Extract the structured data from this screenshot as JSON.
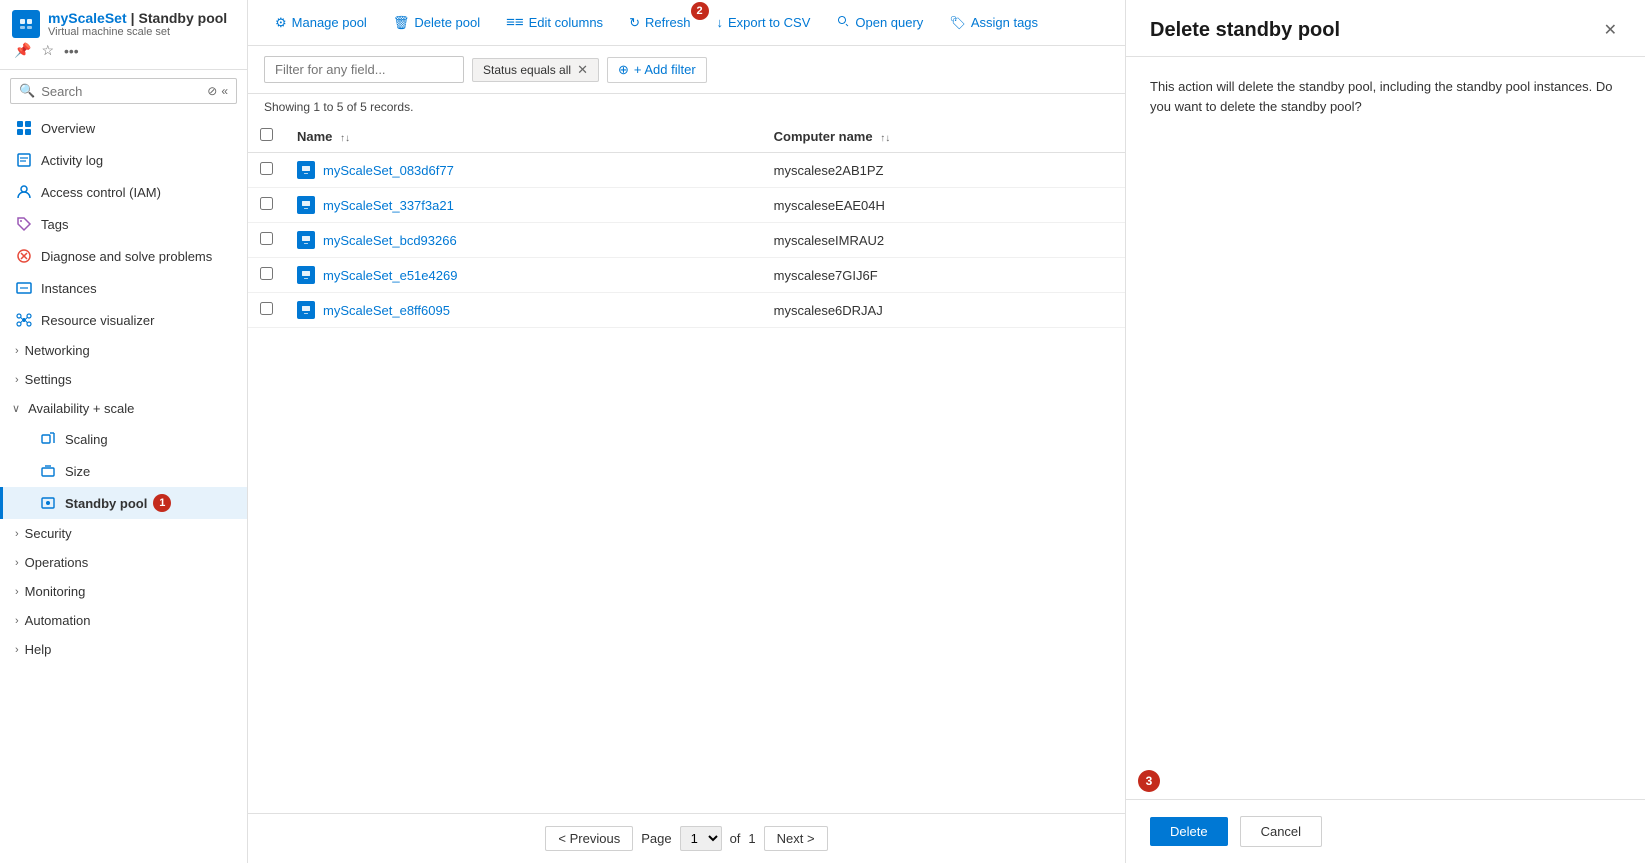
{
  "app": {
    "resource_icon": "⚙",
    "resource_name": "myScaleSet",
    "resource_separator": " | ",
    "resource_page": "Standby pool",
    "resource_subtitle": "Virtual machine scale set",
    "header_actions": [
      "📌",
      "☆",
      "…"
    ]
  },
  "sidebar": {
    "search_placeholder": "Search",
    "nav_items": [
      {
        "id": "overview",
        "label": "Overview",
        "icon": "overview",
        "level": 0
      },
      {
        "id": "activity-log",
        "label": "Activity log",
        "icon": "activity",
        "level": 0
      },
      {
        "id": "iam",
        "label": "Access control (IAM)",
        "icon": "iam",
        "level": 0
      },
      {
        "id": "tags",
        "label": "Tags",
        "icon": "tags",
        "level": 0
      },
      {
        "id": "diagnose",
        "label": "Diagnose and solve problems",
        "icon": "diagnose",
        "level": 0
      },
      {
        "id": "instances",
        "label": "Instances",
        "icon": "instances",
        "level": 0
      },
      {
        "id": "resource-viz",
        "label": "Resource visualizer",
        "icon": "resource-viz",
        "level": 0
      },
      {
        "id": "networking",
        "label": "Networking",
        "icon": "networking",
        "level": 0,
        "hasChevron": true
      },
      {
        "id": "settings",
        "label": "Settings",
        "icon": "settings",
        "level": 0,
        "hasChevron": true
      },
      {
        "id": "availability-scale",
        "label": "Availability + scale",
        "icon": "group",
        "level": 0,
        "expanded": true
      },
      {
        "id": "scaling",
        "label": "Scaling",
        "icon": "scaling",
        "level": 1
      },
      {
        "id": "size",
        "label": "Size",
        "icon": "size",
        "level": 1
      },
      {
        "id": "standby-pool",
        "label": "Standby pool",
        "icon": "standby",
        "level": 1,
        "active": true,
        "badge": "1"
      },
      {
        "id": "security",
        "label": "Security",
        "icon": "security",
        "level": 0,
        "hasChevron": true
      },
      {
        "id": "operations",
        "label": "Operations",
        "icon": "operations",
        "level": 0,
        "hasChevron": true
      },
      {
        "id": "monitoring",
        "label": "Monitoring",
        "icon": "monitoring",
        "level": 0,
        "hasChevron": true
      },
      {
        "id": "automation",
        "label": "Automation",
        "icon": "automation",
        "level": 0,
        "hasChevron": true
      },
      {
        "id": "help",
        "label": "Help",
        "icon": "help",
        "level": 0,
        "hasChevron": true
      }
    ]
  },
  "toolbar": {
    "buttons": [
      {
        "id": "manage-pool",
        "label": "Manage pool",
        "icon": "⚙"
      },
      {
        "id": "delete-pool",
        "label": "Delete pool",
        "icon": "🗑"
      },
      {
        "id": "edit-columns",
        "label": "Edit columns",
        "icon": "≡"
      },
      {
        "id": "refresh",
        "label": "Refresh",
        "icon": "↻",
        "badge": "2"
      },
      {
        "id": "export-csv",
        "label": "Export to CSV",
        "icon": "↓"
      },
      {
        "id": "open-query",
        "label": "Open query",
        "icon": "🔍"
      },
      {
        "id": "assign-tags",
        "label": "Assign tags",
        "icon": "🏷"
      }
    ]
  },
  "filter": {
    "placeholder": "Filter for any field...",
    "active_filter": "Status equals all",
    "add_filter_label": "+ Add filter"
  },
  "table": {
    "record_count": "Showing 1 to 5 of 5 records.",
    "columns": [
      {
        "id": "name",
        "label": "Name",
        "sortable": true
      },
      {
        "id": "computer_name",
        "label": "Computer name",
        "sortable": true
      }
    ],
    "rows": [
      {
        "name": "myScaleSet_083d6f77",
        "computer_name": "myscalese2AB1PZ"
      },
      {
        "name": "myScaleSet_337f3a21",
        "computer_name": "myscaleseEAE04H"
      },
      {
        "name": "myScaleSet_bcd93266",
        "computer_name": "myscaleseIMRAU2"
      },
      {
        "name": "myScaleSet_e51e4269",
        "computer_name": "myscalese7GIJ6F"
      },
      {
        "name": "myScaleSet_e8ff6095",
        "computer_name": "myscalese6DRJAJ"
      }
    ]
  },
  "pagination": {
    "previous_label": "< Previous",
    "next_label": "Next >",
    "page_label": "Page",
    "page_value": "1",
    "of_label": "of",
    "total_pages": "1"
  },
  "delete_panel": {
    "title": "Delete standby pool",
    "description": "This action will delete the standby pool, including the standby pool instances. Do you want to delete the standby pool?",
    "delete_label": "Delete",
    "cancel_label": "Cancel",
    "badge": "3"
  },
  "colors": {
    "accent": "#0078d4",
    "danger": "#c42b1c",
    "border": "#e0e0e0",
    "bg_light": "#f3f2f1"
  }
}
